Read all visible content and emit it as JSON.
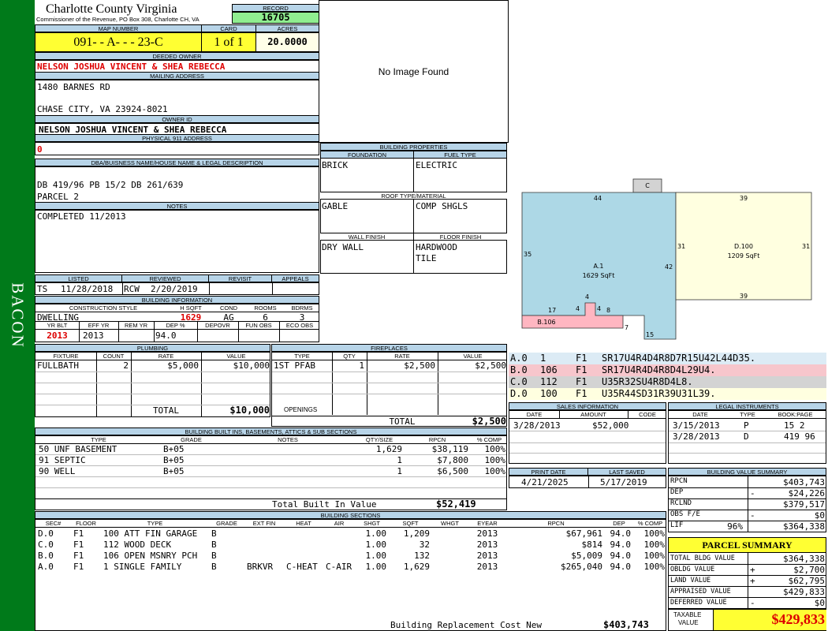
{
  "side_label": "BACON",
  "county": {
    "title": "Charlotte County Virginia",
    "subtitle": "Commissioner of the Revenue, PO Box 308, Charlotte CH, VA"
  },
  "record": {
    "label": "RECORD",
    "value": "16705"
  },
  "map": {
    "label": "MAP NUMBER",
    "value": "091- - A- - - 23-C",
    "card_label": "CARD",
    "card": "1 of 1",
    "acres_label": "ACRES",
    "acres": "20.0000"
  },
  "owner": {
    "deeded_label": "DEEDED OWNER",
    "deeded": "NELSON JOSHUA VINCENT & SHEA REBECCA",
    "mailing_label": "MAILING ADDRESS",
    "addr1": "1480 BARNES RD",
    "addr2": "CHASE CITY, VA 23924-8021",
    "id_label": "OWNER ID",
    "id_value": "NELSON JOSHUA VINCENT & SHEA REBECCA",
    "phys_label": "PHYSICAL 911 ADDRESS",
    "phys_value": "0"
  },
  "legal": {
    "label": "DBA/BUISNESS NAME/HOUSE NAME & LEGAL DESCRIPTION",
    "line1": "DB 419/96 PB 15/2 DB 261/639",
    "line2": "PARCEL 2"
  },
  "notes": {
    "label": "NOTES",
    "text": "COMPLETED 11/2013"
  },
  "image_text": "No Image Found",
  "listing": {
    "listed_label": "LISTED",
    "listed_by": "TS",
    "listed_date": "11/28/2018",
    "reviewed_label": "REVIEWED",
    "reviewed_by": "RCW",
    "reviewed_date": "2/20/2019",
    "revisit_label": "REVISIT",
    "appeals_label": "APPEALS"
  },
  "building_info": {
    "label": "BUILDING INFORMATION",
    "cols": [
      "CONSTRUCTION STYLE",
      "H SQFT",
      "COND",
      "ROOMS",
      "BDRMS"
    ],
    "style": "DWELLING",
    "hsqft": "1629",
    "cond": "AG",
    "rooms": "6",
    "bdrms": "3",
    "cols2": [
      "YR BLT",
      "EFF YR",
      "REM YR",
      "DEP %",
      "DEPOVR",
      "FUN OBS",
      "ECO OBS"
    ],
    "yr_blt": "2013",
    "eff_yr": "2013",
    "dep": "94.0"
  },
  "bprops": {
    "label": "BUILDING PROPERTIES",
    "foundation_label": "FOUNDATION",
    "foundation": "BRICK",
    "fuel_label": "FUEL TYPE",
    "fuel": "ELECTRIC",
    "roof_label": "ROOF TYPE/MATERIAL",
    "roof1": "GABLE",
    "roof2": "COMP SHGLS",
    "wall_label": "WALL FINISH",
    "wall": "DRY WALL",
    "floor_label": "FLOOR FINISH",
    "floor1": "HARDWOOD",
    "floor2": "TILE"
  },
  "sketch": {
    "c_label": "C",
    "a_label": "A.1",
    "a_area": "1629 SqFt",
    "d_label": "D.100",
    "d_area": "1209 SqFt",
    "b_label": "B.106",
    "dims": {
      "a_top": "44",
      "a_left": "35",
      "a_right": "42",
      "a_bottom": "15",
      "a_inner7": "7",
      "a_17": "17",
      "a_4a": "4",
      "a_4b": "4",
      "a_4c": "4",
      "a_8": "8",
      "d_top": "39",
      "d_left": "31",
      "d_right": "31",
      "d_bottom": "39"
    }
  },
  "sketch_legend": [
    {
      "id": "A.0",
      "num": "1",
      "flr": "F1",
      "code": "SR17U4R4D4R8D7R15U42L44D35.",
      "color": "#dcebf5"
    },
    {
      "id": "B.0",
      "num": "106",
      "flr": "F1",
      "code": "SR17U4R4D4R8D4L29U4.",
      "color": "#f7c6cc"
    },
    {
      "id": "C.0",
      "num": "112",
      "flr": "F1",
      "code": "U35R32SU4R8D4L8.",
      "color": "#d3d3d3"
    },
    {
      "id": "D.0",
      "num": "100",
      "flr": "F1",
      "code": "U35R44SD31R39U31L39.",
      "color": "#ffffe0"
    }
  ],
  "plumbing": {
    "label": "PLUMBING",
    "cols": [
      "FIXTURE",
      "COUNT",
      "RATE",
      "VALUE"
    ],
    "rows": [
      {
        "fixture": "FULLBATH",
        "count": "2",
        "rate": "$5,000",
        "value": "$10,000"
      }
    ],
    "total_label": "TOTAL",
    "total": "$10,000"
  },
  "fireplaces": {
    "label": "FIREPLACES",
    "cols": [
      "TYPE",
      "QTY",
      "RATE",
      "VALUE"
    ],
    "rows": [
      {
        "type": "1ST PFAB",
        "qty": "1",
        "rate": "$2,500",
        "value": "$2,500"
      }
    ],
    "openings_label": "OPENINGS",
    "total_label": "TOTAL",
    "total": "$2,500"
  },
  "builtins": {
    "label": "BUILDING BUILT INS, BASEMENTS, ATTICS & SUB SECTIONS",
    "cols": [
      "TYPE",
      "GRADE",
      "NOTES",
      "QTY/SIZE",
      "RPCN",
      "% COMP"
    ],
    "rows": [
      {
        "type": "50 UNF BASEMENT",
        "grade": "B+05",
        "notes": "",
        "qty": "1,629",
        "rpcn": "$38,119",
        "comp": "100%"
      },
      {
        "type": "91 SEPTIC",
        "grade": "B+05",
        "notes": "",
        "qty": "1",
        "rpcn": "$7,800",
        "comp": "100%"
      },
      {
        "type": "90 WELL",
        "grade": "B+05",
        "notes": "",
        "qty": "1",
        "rpcn": "$6,500",
        "comp": "100%"
      }
    ],
    "total_label": "Total Built In Value",
    "total": "$52,419"
  },
  "sales": {
    "label": "SALES INFORMATION",
    "cols": [
      "DATE",
      "AMOUNT",
      "CODE"
    ],
    "rows": [
      {
        "date": "3/28/2013",
        "amount": "$52,000",
        "code": ""
      }
    ]
  },
  "legal_instr": {
    "label": "LEGAL INSTRUMENTS",
    "cols": [
      "DATE",
      "TYPE",
      "BOOK:PAGE"
    ],
    "rows": [
      {
        "date": "3/15/2013",
        "type": "P",
        "book": "15 2"
      },
      {
        "date": "3/28/2013",
        "type": "D",
        "book": "419 96"
      }
    ]
  },
  "print": {
    "print_label": "PRINT DATE",
    "print_date": "4/21/2025",
    "saved_label": "LAST SAVED",
    "saved_date": "5/17/2019"
  },
  "bvs": {
    "label": "BUILDING VALUE SUMMARY",
    "rows": [
      {
        "k": "RPCN",
        "s": "",
        "v": "$403,743"
      },
      {
        "k": "DEP",
        "s": "-",
        "v": "$24,226"
      },
      {
        "k": "RCLND",
        "s": "",
        "v": "$379,517"
      },
      {
        "k": "OBS F/E",
        "s": "-",
        "v": "$0"
      },
      {
        "k": "LIF",
        "p": "96%",
        "s": "",
        "v": "$364,338"
      }
    ]
  },
  "parcel": {
    "label": "PARCEL SUMMARY",
    "rows": [
      {
        "k": "TOTAL BLDG VALUE",
        "s": "",
        "v": "$364,338"
      },
      {
        "k": "OBLDG VALUE",
        "s": "+",
        "v": "$2,700"
      },
      {
        "k": "LAND VALUE",
        "s": "+",
        "v": "$62,795"
      },
      {
        "k": "APPRAISED VALUE",
        "s": "",
        "v": "$429,833"
      },
      {
        "k": "DEFERRED VALUE",
        "s": "-",
        "v": "$0"
      }
    ],
    "taxable_label1": "TAXABLE",
    "taxable_label2": "VALUE",
    "taxable": "$429,833"
  },
  "sections": {
    "label": "BUILDING SECTIONS",
    "cols": [
      "SEC#",
      "FLOOR",
      "TYPE",
      "GRADE",
      "EXT FIN",
      "HEAT",
      "AIR",
      "SHGT",
      "SQFT",
      "WHGT",
      "EYEAR",
      "RPCN",
      "DEP",
      "% COMP"
    ],
    "rows": [
      {
        "sec": "D.0",
        "floor": "F1",
        "type": "100 ATT FIN GARAGE",
        "grade": "B",
        "ext": "",
        "heat": "",
        "air": "",
        "shgt": "1.00",
        "sqft": "1,209",
        "whgt": "",
        "eyear": "2013",
        "rpcn": "$67,961",
        "dep": "94.0",
        "comp": "100%"
      },
      {
        "sec": "C.0",
        "floor": "F1",
        "type": "112 WOOD DECK",
        "grade": "B",
        "ext": "",
        "heat": "",
        "air": "",
        "shgt": "1.00",
        "sqft": "32",
        "whgt": "",
        "eyear": "2013",
        "rpcn": "$814",
        "dep": "94.0",
        "comp": "100%"
      },
      {
        "sec": "B.0",
        "floor": "F1",
        "type": "106 OPEN MSNRY PCH",
        "grade": "B",
        "ext": "",
        "heat": "",
        "air": "",
        "shgt": "1.00",
        "sqft": "132",
        "whgt": "",
        "eyear": "2013",
        "rpcn": "$5,009",
        "dep": "94.0",
        "comp": "100%"
      },
      {
        "sec": "A.0",
        "floor": "F1",
        "type": "1 SINGLE FAMILY",
        "grade": "B",
        "ext": "BRKVR",
        "heat": "C-HEAT",
        "air": "C-AIR",
        "shgt": "1.00",
        "sqft": "1,629",
        "whgt": "",
        "eyear": "2013",
        "rpcn": "$265,040",
        "dep": "94.0",
        "comp": "100%"
      }
    ],
    "total_label": "Building Replacement Cost New",
    "total": "$403,743"
  }
}
